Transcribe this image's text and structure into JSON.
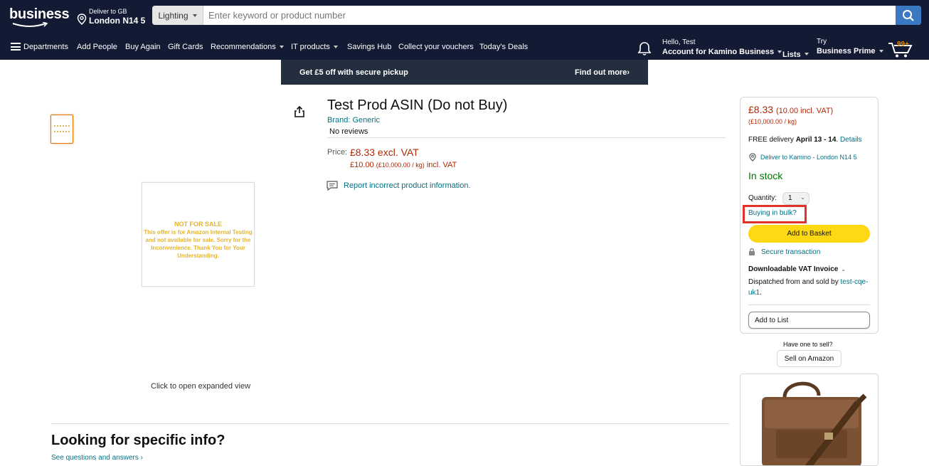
{
  "header": {
    "logo": "business",
    "deliver_line1": "Deliver to GB",
    "deliver_line2": "London N14 5",
    "search_category": "Lighting",
    "search_placeholder": "Enter keyword or product number",
    "greeting": "Hello, Test",
    "account": "Account for Kamino Business",
    "lists": "Lists",
    "try": "Try",
    "prime": "Business Prime",
    "cart_count": "99+"
  },
  "nav": {
    "departments": "Departments",
    "items": [
      "Add People",
      "Buy Again",
      "Gift Cards",
      "Recommendations",
      "IT products",
      "Savings Hub",
      "Collect your vouchers",
      "Today's Deals"
    ]
  },
  "promo": {
    "left": "Get £5 off with secure pickup",
    "right": "Find out more›"
  },
  "image_panel": {
    "not_for_sale": "NOT FOR SALE",
    "notice": "This offer is for Amazon Internal Testing and not available for sale. Sorry for the Inconvenience. Thank You for Your Understanding.",
    "click_expand": "Click to open expanded view"
  },
  "product": {
    "title": "Test Prod ASIN (Do not Buy)",
    "brand": "Brand: Generic",
    "reviews": "No reviews",
    "price_label": "Price:",
    "price_main": "£8.33 excl. VAT",
    "price_incl_a": "£10.00",
    "price_incl_unit": "(£10,000.00 / kg)",
    "price_incl_b": "incl. VAT",
    "report": "Report incorrect product information."
  },
  "lower": {
    "heading": "Looking for specific info?",
    "see_qa": "See questions and answers ›"
  },
  "buybox": {
    "price": "£8.33",
    "price_incl": "(10.00 incl. VAT)",
    "unit": "(£10,000.00 / kg)",
    "delivery_pre": "FREE delivery",
    "delivery_dates": "April 13 - 14",
    "delivery_sep": ".",
    "details": "Details",
    "deliver_to": "Deliver to Kamino - London N14 5",
    "stock": "In stock",
    "qty_label": "Quantity:",
    "qty_value": "1",
    "bulk": "Buying in bulk?",
    "add_basket": "Add to Basket",
    "secure": "Secure transaction",
    "vat_invoice": "Downloadable VAT Invoice",
    "dispatched": "Dispatched from and sold by",
    "seller": "test-cqe-uk1",
    "seller_end": ".",
    "add_list": "Add to List"
  },
  "sell": {
    "question": "Have one to sell?",
    "button": "Sell on Amazon"
  },
  "colors": {
    "header_bg": "#131a33",
    "price_red": "#b12704",
    "link_teal": "#007185",
    "stock_green": "#007600",
    "basket_yellow": "#ffd814",
    "highlight_red": "#e1322a"
  }
}
